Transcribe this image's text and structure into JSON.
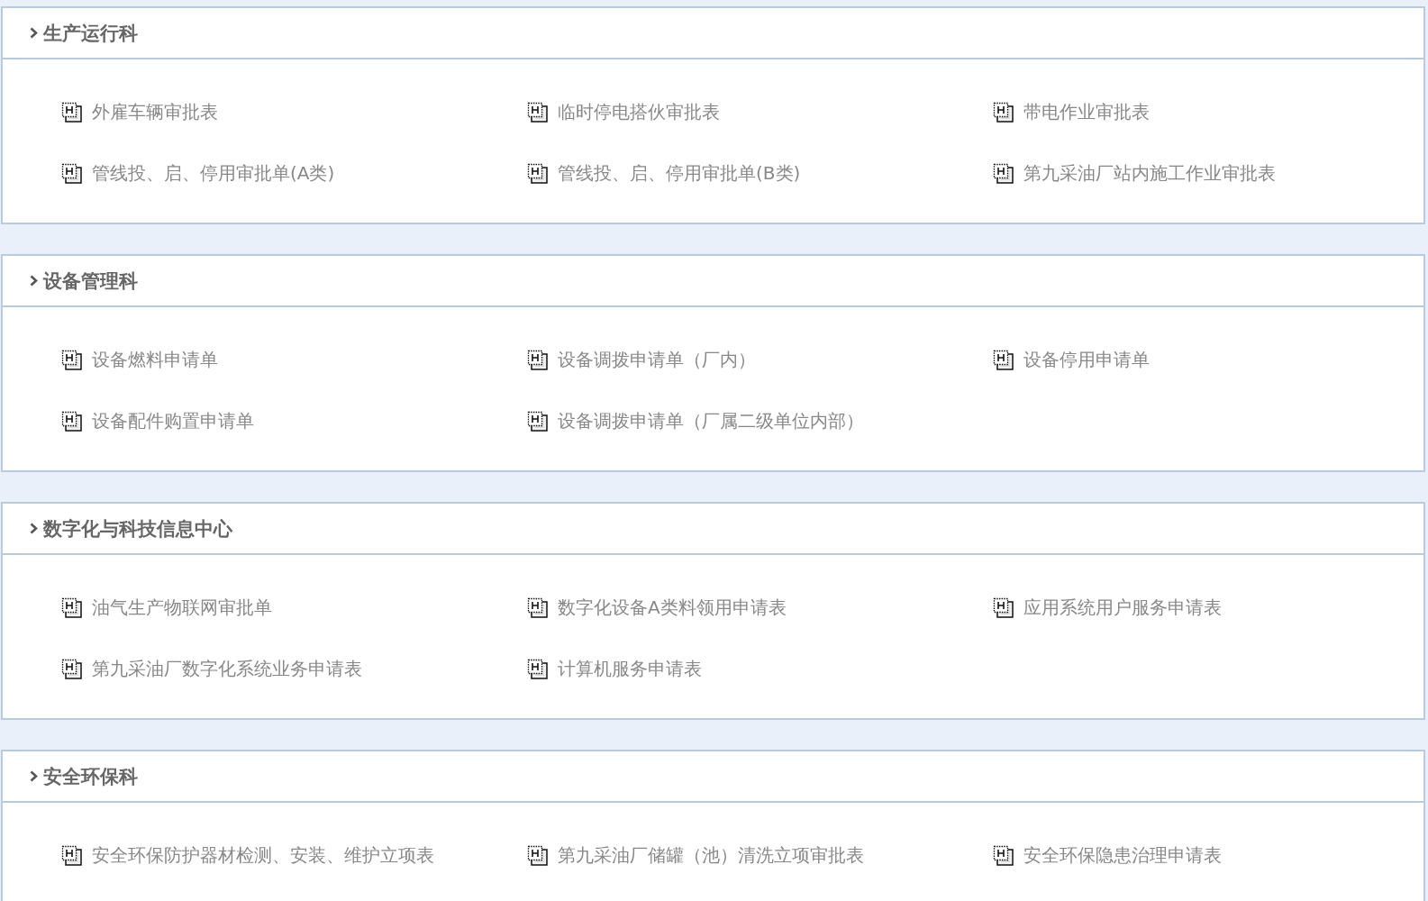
{
  "sections": [
    {
      "title": "生产运行科",
      "items": [
        "外雇车辆审批表",
        "临时停电搭伙审批表",
        "带电作业审批表",
        "管线投、启、停用审批单(A类)",
        "管线投、启、停用审批单(B类)",
        "第九采油厂站内施工作业审批表"
      ]
    },
    {
      "title": "设备管理科",
      "items": [
        "设备燃料申请单",
        "设备调拨申请单（厂内）",
        "设备停用申请单",
        "设备配件购置申请单",
        "设备调拨申请单（厂属二级单位内部）"
      ]
    },
    {
      "title": "数字化与科技信息中心",
      "items": [
        "油气生产物联网审批单",
        "数字化设备A类料领用申请表",
        "应用系统用户服务申请表",
        "第九采油厂数字化系统业务申请表",
        "计算机服务申请表"
      ]
    },
    {
      "title": "安全环保科",
      "items": [
        "安全环保防护器材检测、安装、维护立项表",
        "第九采油厂储罐（池）清洗立项审批表",
        "安全环保隐患治理申请表"
      ]
    }
  ]
}
